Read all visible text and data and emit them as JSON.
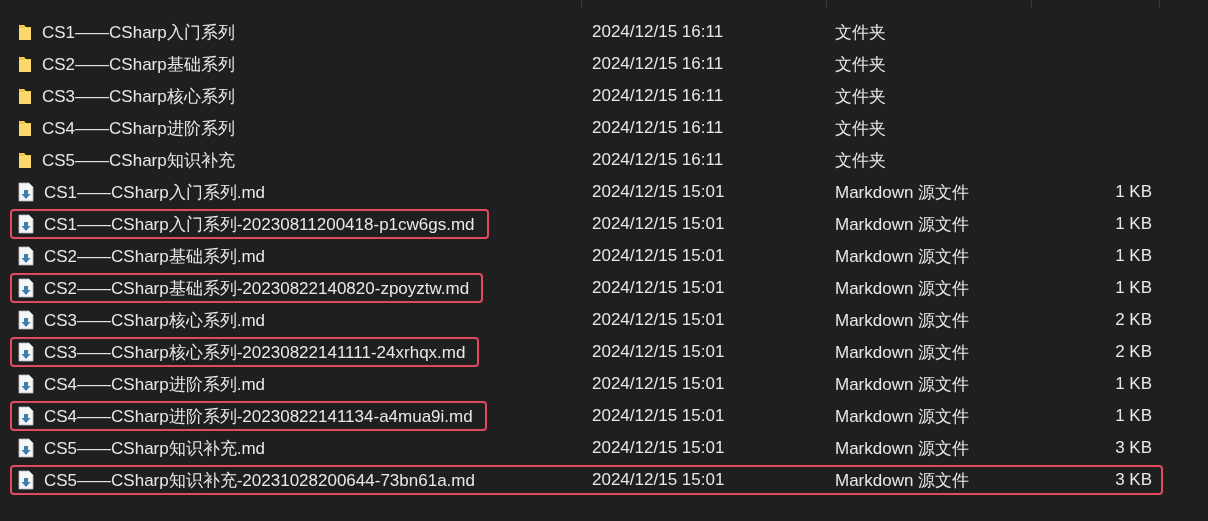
{
  "rows": [
    {
      "kind": "folder",
      "name": "CS1——CSharp入门系列",
      "modified": "2024/12/15 16:11",
      "type": "文件夹",
      "name_outlined": false,
      "row_outlined": false
    },
    {
      "kind": "folder",
      "name": "CS2——CSharp基础系列",
      "modified": "2024/12/15 16:11",
      "type": "文件夹",
      "name_outlined": false,
      "row_outlined": false
    },
    {
      "kind": "folder",
      "name": "CS3——CSharp核心系列",
      "modified": "2024/12/15 16:11",
      "type": "文件夹",
      "name_outlined": false,
      "row_outlined": false
    },
    {
      "kind": "folder",
      "name": "CS4——CSharp进阶系列",
      "modified": "2024/12/15 16:11",
      "type": "文件夹",
      "name_outlined": false,
      "row_outlined": false
    },
    {
      "kind": "folder",
      "name": "CS5——CSharp知识补充",
      "modified": "2024/12/15 16:11",
      "type": "文件夹",
      "name_outlined": false,
      "row_outlined": false
    },
    {
      "kind": "file",
      "name": "CS1——CSharp入门系列.md",
      "modified": "2024/12/15 15:01",
      "type": "Markdown 源文件",
      "size": "1 KB",
      "name_outlined": false,
      "row_outlined": false
    },
    {
      "kind": "file",
      "name": "CS1——CSharp入门系列-20230811200418-p1cw6gs.md",
      "modified": "2024/12/15 15:01",
      "type": "Markdown 源文件",
      "size": "1 KB",
      "name_outlined": true,
      "row_outlined": false
    },
    {
      "kind": "file",
      "name": "CS2——CSharp基础系列.md",
      "modified": "2024/12/15 15:01",
      "type": "Markdown 源文件",
      "size": "1 KB",
      "name_outlined": false,
      "row_outlined": false
    },
    {
      "kind": "file",
      "name": "CS2——CSharp基础系列-20230822140820-zpoyztw.md",
      "modified": "2024/12/15 15:01",
      "type": "Markdown 源文件",
      "size": "1 KB",
      "name_outlined": true,
      "row_outlined": false
    },
    {
      "kind": "file",
      "name": "CS3——CSharp核心系列.md",
      "modified": "2024/12/15 15:01",
      "type": "Markdown 源文件",
      "size": "2 KB",
      "name_outlined": false,
      "row_outlined": false
    },
    {
      "kind": "file",
      "name": "CS3——CSharp核心系列-20230822141111-24xrhqx.md",
      "modified": "2024/12/15 15:01",
      "type": "Markdown 源文件",
      "size": "2 KB",
      "name_outlined": true,
      "row_outlined": false
    },
    {
      "kind": "file",
      "name": "CS4——CSharp进阶系列.md",
      "modified": "2024/12/15 15:01",
      "type": "Markdown 源文件",
      "size": "1 KB",
      "name_outlined": false,
      "row_outlined": false
    },
    {
      "kind": "file",
      "name": "CS4——CSharp进阶系列-20230822141134-a4mua9i.md",
      "modified": "2024/12/15 15:01",
      "type": "Markdown 源文件",
      "size": "1 KB",
      "name_outlined": true,
      "row_outlined": false
    },
    {
      "kind": "file",
      "name": "CS5——CSharp知识补充.md",
      "modified": "2024/12/15 15:01",
      "type": "Markdown 源文件",
      "size": "3 KB",
      "name_outlined": false,
      "row_outlined": false
    },
    {
      "kind": "file",
      "name": "CS5——CSharp知识补充-20231028200644-73bn61a.md",
      "modified": "2024/12/15 15:01",
      "type": "Markdown 源文件",
      "size": "3 KB",
      "name_outlined": false,
      "row_outlined": true
    }
  ]
}
